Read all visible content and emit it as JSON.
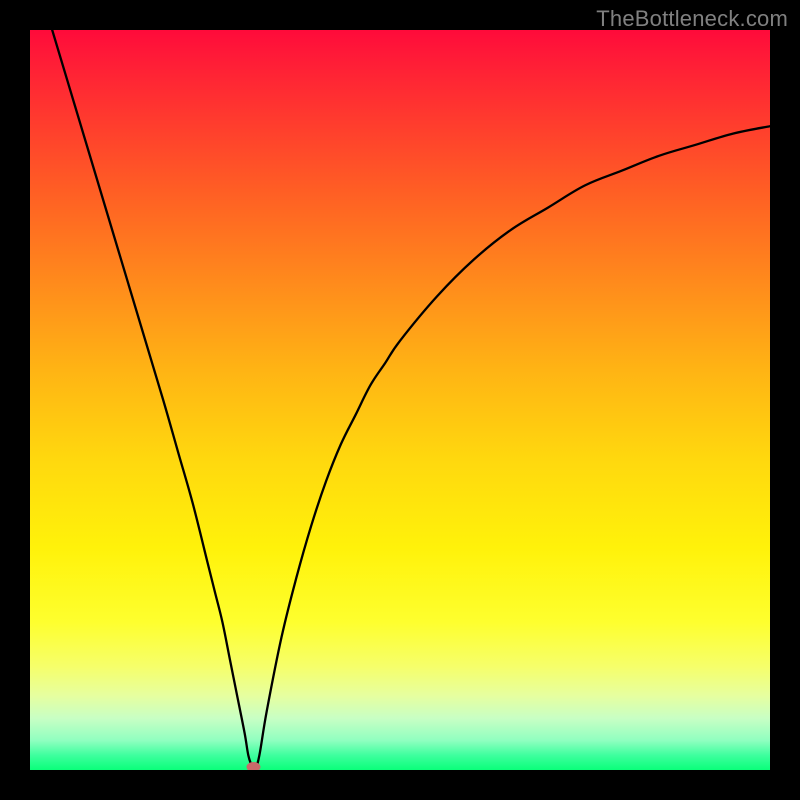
{
  "watermark": "TheBottleneck.com",
  "chart_data": {
    "type": "line",
    "title": "",
    "xlabel": "",
    "ylabel": "",
    "xlim": [
      0,
      100
    ],
    "ylim": [
      0,
      100
    ],
    "grid": false,
    "legend": false,
    "x": [
      3,
      6,
      9,
      12,
      15,
      18,
      20,
      22,
      24,
      25,
      26,
      27,
      28,
      29,
      29.5,
      30,
      30.4,
      31,
      32,
      34,
      36,
      38,
      40,
      42,
      44,
      46,
      48,
      50,
      55,
      60,
      65,
      70,
      75,
      80,
      85,
      90,
      95,
      100
    ],
    "values": [
      100,
      90,
      80,
      70,
      60,
      50,
      43,
      36,
      28,
      24,
      20,
      15,
      10,
      5,
      2,
      0.5,
      0,
      2,
      8,
      18,
      26,
      33,
      39,
      44,
      48,
      52,
      55,
      58,
      64,
      69,
      73,
      76,
      79,
      81,
      83,
      84.5,
      86,
      87
    ],
    "marker": {
      "x": 30.2,
      "y": 0
    }
  },
  "colors": {
    "curve": "#000000",
    "dot": "#c96a6a",
    "frame": "#000000"
  }
}
